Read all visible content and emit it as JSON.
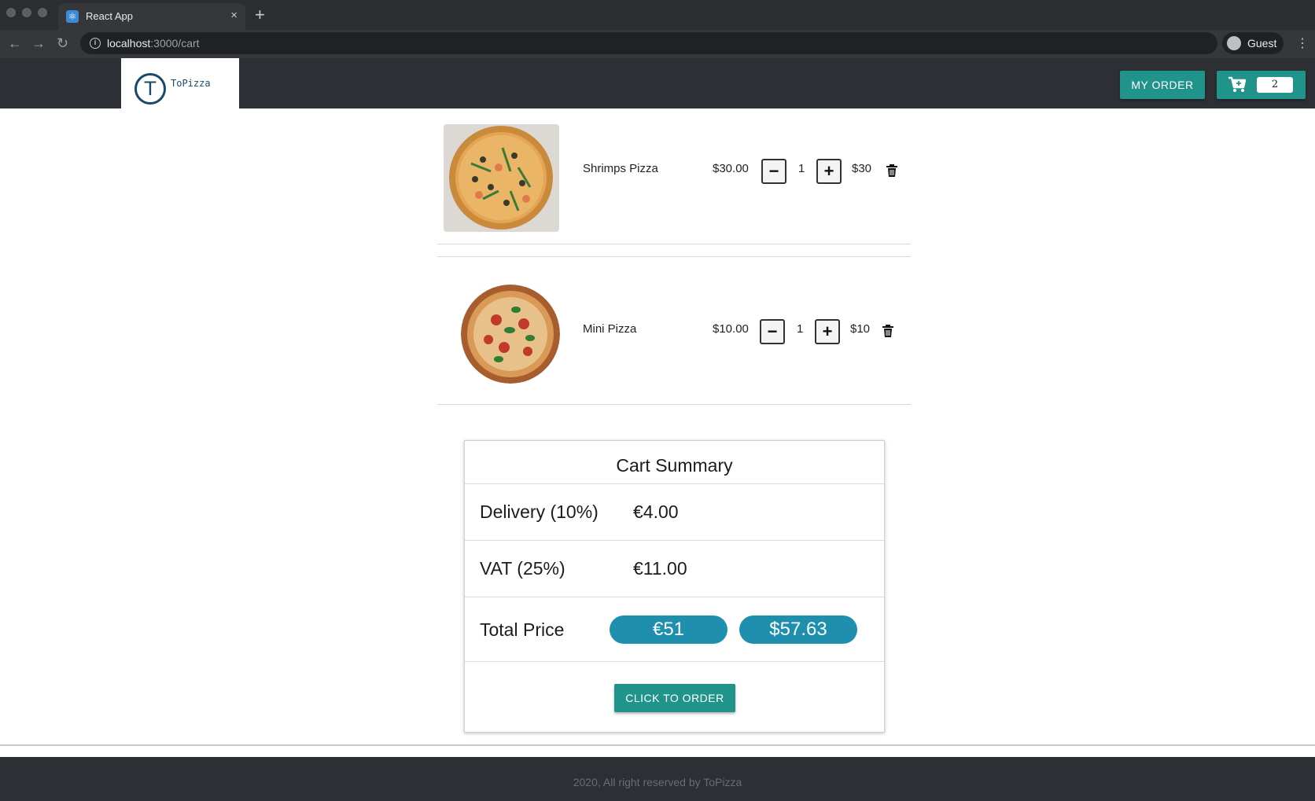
{
  "browser": {
    "tab_title": "React App",
    "tab_close": "×",
    "new_tab": "+",
    "url_host": "localhost",
    "url_path": ":3000/cart",
    "profile_label": "Guest"
  },
  "header": {
    "logo_letter": "T",
    "logo_text": "ToPizza",
    "my_order_label": "MY ORDER",
    "cart_count": "2"
  },
  "cart": {
    "items": [
      {
        "name": "Shrimps Pizza",
        "price": "$30.00",
        "quantity": "1",
        "total": "$30"
      },
      {
        "name": "Mini Pizza",
        "price": "$10.00",
        "quantity": "1",
        "total": "$10"
      }
    ],
    "minus_label": "−",
    "plus_label": "+"
  },
  "summary": {
    "title": "Cart Summary",
    "delivery_label": "Delivery (10%)",
    "delivery_value": "€4.00",
    "vat_label": "VAT (25%)",
    "vat_value": "€11.00",
    "total_label": "Total Price",
    "total_eur": "€51",
    "total_usd": "$57.63",
    "order_button": "CLICK TO ORDER"
  },
  "footer": {
    "text": "2020, All right reserved by ToPizza"
  },
  "colors": {
    "accent": "#20938a",
    "pill": "#1f8fae",
    "header_bg": "#2c2f33"
  }
}
